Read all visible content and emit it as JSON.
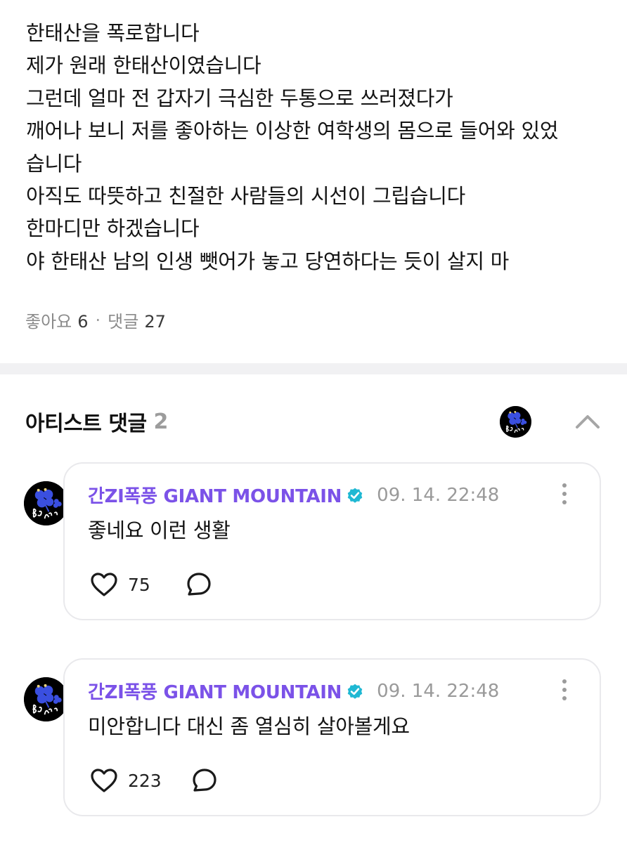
{
  "post": {
    "lines": [
      "한태산을 폭로합니다",
      "제가 원래 한태산이였습니다",
      "그런데 얼마 전 갑자기 극심한 두통으로 쓰러졌다가",
      "깨어나 보니 저를 좋아하는 이상한 여학생의 몸으로 들어와 있었",
      "습니다",
      "아직도 따뜻하고 친절한 사람들의 시선이 그립습니다",
      "한마디만 하겠습니다",
      "야 한태산 남의 인생 뺏어가 놓고 당연하다는 듯이 살지 마"
    ],
    "likes_label": "좋아요",
    "likes_count": "6",
    "separator": "·",
    "comments_label": "댓글",
    "comments_count": "27"
  },
  "artist_comments": {
    "title": "아티스트 댓글",
    "count": "2",
    "items": [
      {
        "author": "간ZI폭풍 GIANT MOUNTAIN",
        "time": "09. 14. 22:48",
        "text": "좋네요 이런 생활",
        "likes": "75"
      },
      {
        "author": "간ZI폭풍 GIANT MOUNTAIN",
        "time": "09. 14. 22:48",
        "text": "미안합니다 대신 좀 열심히 살아볼게요",
        "likes": "223"
      }
    ]
  },
  "icons": {
    "verified": "verified-badge-icon",
    "like": "heart-outline-icon",
    "reply": "speech-bubble-icon",
    "more": "vertical-dots-icon",
    "collapse": "chevron-up-icon"
  },
  "colors": {
    "author": "#7b52e8",
    "verified_badge": "#1fb8d3",
    "muted": "#9a9a9a",
    "divider": "#f1f1f3",
    "avatar_clover": "#3a4fe0"
  }
}
